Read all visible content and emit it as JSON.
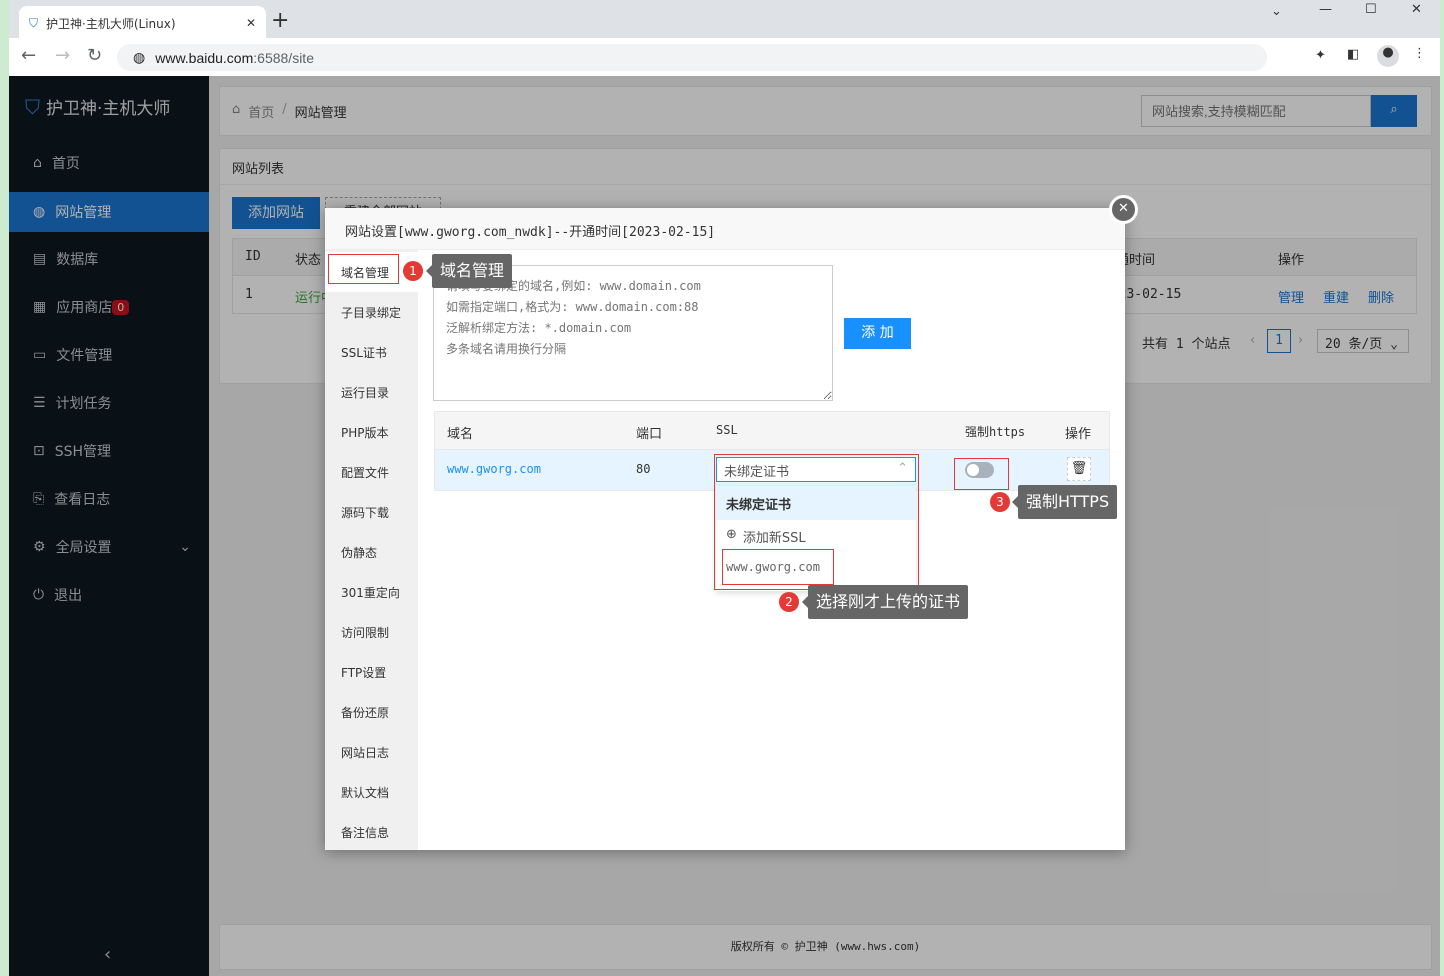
{
  "browser": {
    "tab_title": "护卫神·主机大师(Linux)",
    "url_host": "www.baidu.com",
    "url_rest": ":6588/site"
  },
  "sidebar": {
    "logo": "护卫神·主机大师",
    "items": [
      {
        "label": "首页",
        "icon": "home-icon"
      },
      {
        "label": "网站管理",
        "icon": "globe-icon",
        "active": true
      },
      {
        "label": "数据库",
        "icon": "database-icon"
      },
      {
        "label": "应用商店",
        "icon": "apps-icon",
        "badge": "0"
      },
      {
        "label": "文件管理",
        "icon": "folder-icon"
      },
      {
        "label": "计划任务",
        "icon": "list-icon"
      },
      {
        "label": "SSH管理",
        "icon": "terminal-icon"
      },
      {
        "label": "查看日志",
        "icon": "log-icon"
      },
      {
        "label": "全局设置",
        "icon": "gear-icon"
      },
      {
        "label": "退出",
        "icon": "logout-icon"
      }
    ],
    "collapse": "‹"
  },
  "header": {
    "breadcrumb_home": "首页",
    "breadcrumb_sep": "/",
    "breadcrumb_current": "网站管理",
    "search_placeholder": "网站搜索,支持模糊匹配"
  },
  "site_list": {
    "title": "网站列表",
    "add_button": "添加网站",
    "rebuild_button": "重建全部网站",
    "columns": {
      "id": "ID",
      "status": "状态",
      "open_time": "开通时间",
      "actions": "操作"
    },
    "row": {
      "id": "1",
      "status": "运行中",
      "open_time": "2023-02-15",
      "manage": "管理",
      "rebuild": "重建",
      "delete": "删除"
    },
    "pagination": {
      "total": "共有 1 个站点",
      "page": "1",
      "page_size": "20 条/页"
    }
  },
  "footer": "版权所有 © 护卫神 (www.hws.com)",
  "modal": {
    "title": "网站设置[www.gworg.com_nwdk]--开通时间[2023-02-15]",
    "tabs": [
      "域名管理",
      "子目录绑定",
      "SSL证书",
      "运行目录",
      "PHP版本",
      "配置文件",
      "源码下载",
      "伪静态",
      "301重定向",
      "访问限制",
      "FTP设置",
      "备份还原",
      "网站日志",
      "默认文档",
      "备注信息"
    ],
    "domain_placeholder": "请填写要绑定的域名,例如: www.domain.com\n如需指定端口,格式为: www.domain.com:88\n泛解析绑定方法: *.domain.com\n多条域名请用换行分隔",
    "add_button": "添 加",
    "table": {
      "columns": [
        "域名",
        "端口",
        "SSL",
        "强制https",
        "操作"
      ],
      "row": {
        "domain": "www.gworg.com",
        "port": "80",
        "ssl": "未绑定证书",
        "force_https": false
      }
    },
    "ssl_options": [
      "未绑定证书",
      "添加新SSL",
      "www.gworg.com"
    ]
  },
  "annotations": [
    {
      "num": "1",
      "text": "域名管理"
    },
    {
      "num": "2",
      "text": "选择刚才上传的证书"
    },
    {
      "num": "3",
      "text": "强制HTTPS"
    }
  ],
  "colors": {
    "accent": "#1a76d2",
    "sidebar": "#0d1820",
    "annotation": "#e53935"
  }
}
